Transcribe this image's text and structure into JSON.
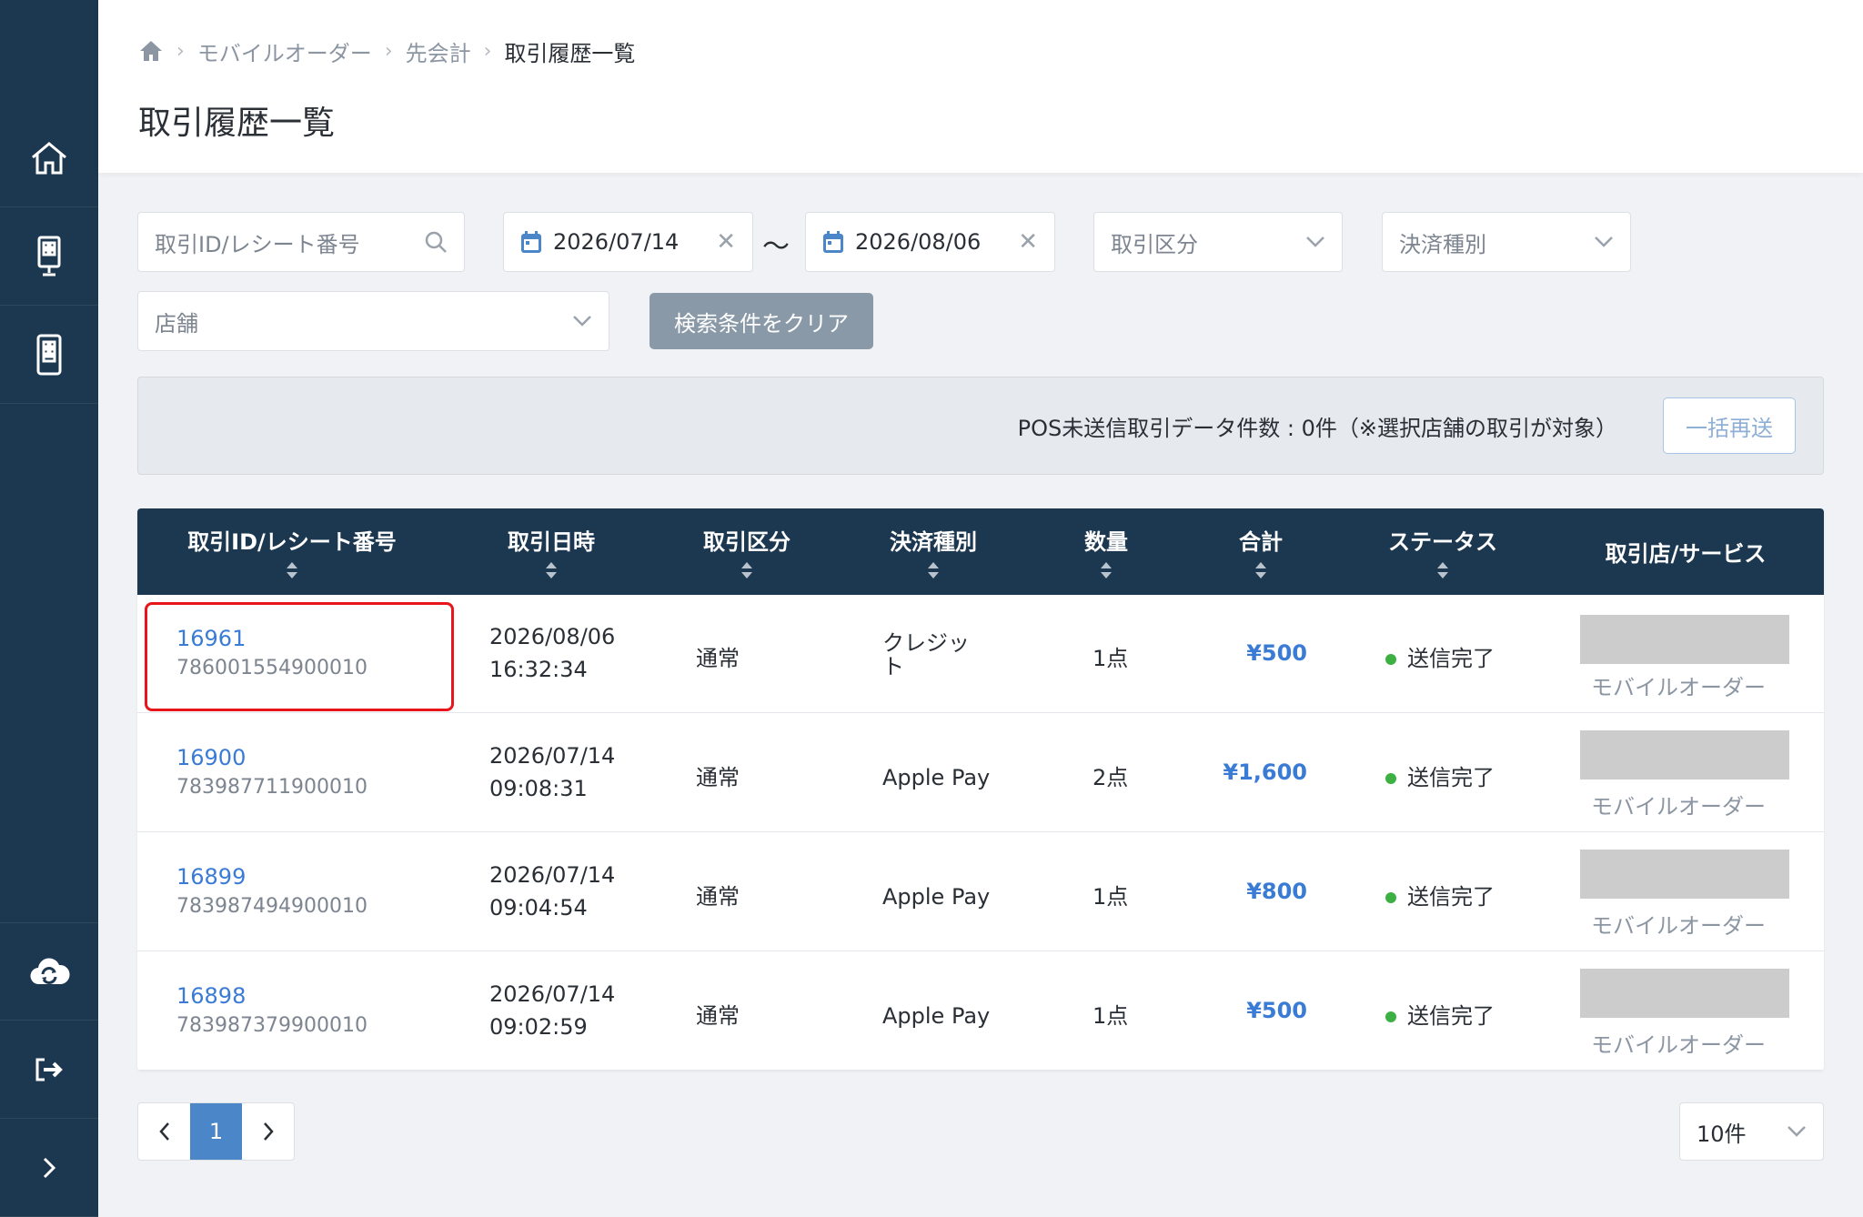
{
  "breadcrumb": {
    "items": [
      "モバイルオーダー",
      "先会計"
    ],
    "current": "取引履歴一覧"
  },
  "page": {
    "title": "取引履歴一覧"
  },
  "filters": {
    "id_placeholder": "取引ID/レシート番号",
    "date_from": "2026/07/14",
    "date_separator": "〜",
    "date_to": "2026/08/06",
    "type_placeholder": "取引区分",
    "payment_placeholder": "決済種別",
    "store_placeholder": "店舗",
    "clear_label": "検索条件をクリア"
  },
  "pos": {
    "text": "POS未送信取引データ件数 : 0件（※選択店舗の取引が対象）",
    "resend_label": "一括再送"
  },
  "table": {
    "columns": [
      "取引ID/レシート番号",
      "取引日時",
      "取引区分",
      "決済種別",
      "数量",
      "合計",
      "ステータス",
      "取引店/サービス"
    ],
    "rows": [
      {
        "id": "16961",
        "receipt": "786001554900010",
        "date": "2026/08/06",
        "time": "16:32:34",
        "type": "通常",
        "payment": "クレジット",
        "qty": "1点",
        "total": "¥500",
        "status": "送信完了",
        "service": "モバイルオーダー"
      },
      {
        "id": "16900",
        "receipt": "783987711900010",
        "date": "2026/07/14",
        "time": "09:08:31",
        "type": "通常",
        "payment": "Apple Pay",
        "qty": "2点",
        "total": "¥1,600",
        "status": "送信完了",
        "service": "モバイルオーダー"
      },
      {
        "id": "16899",
        "receipt": "783987494900010",
        "date": "2026/07/14",
        "time": "09:04:54",
        "type": "通常",
        "payment": "Apple Pay",
        "qty": "1点",
        "total": "¥800",
        "status": "送信完了",
        "service": "モバイルオーダー"
      },
      {
        "id": "16898",
        "receipt": "783987379900010",
        "date": "2026/07/14",
        "time": "09:02:59",
        "type": "通常",
        "payment": "Apple Pay",
        "qty": "1点",
        "total": "¥500",
        "status": "送信完了",
        "service": "モバイルオーダー"
      }
    ]
  },
  "pagination": {
    "current": "1",
    "per_page": "10件"
  },
  "colors": {
    "sidebar": "#1c3850",
    "accent": "#3a7bd5",
    "status_ok": "#3cb043",
    "highlight": "#e8151b"
  }
}
